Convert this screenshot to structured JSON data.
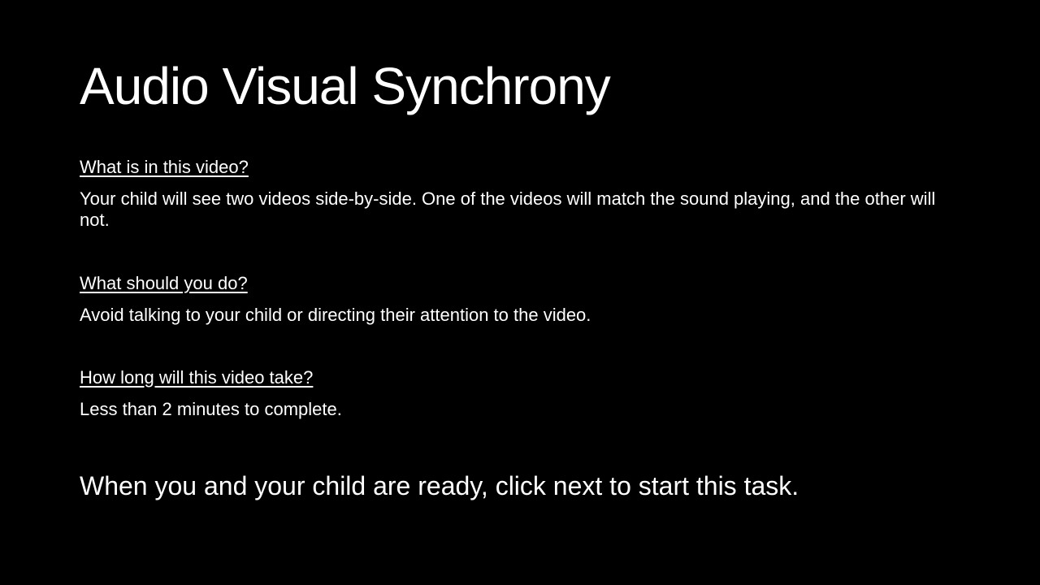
{
  "slide": {
    "title": "Audio Visual Synchrony",
    "sections": [
      {
        "heading": "What is in this video?",
        "text": "Your child will see two videos side-by-side. One of the videos will match the sound playing, and the other will not."
      },
      {
        "heading": "What should you do?",
        "text": "Avoid talking to your child or directing their attention to the video."
      },
      {
        "heading": "How long will this video take?",
        "text": "Less than 2 minutes to complete."
      }
    ],
    "call_to_action": "When you and your child are ready, click next to start this task.",
    "colors": {
      "background": "#000000",
      "text": "#ffffff"
    }
  }
}
